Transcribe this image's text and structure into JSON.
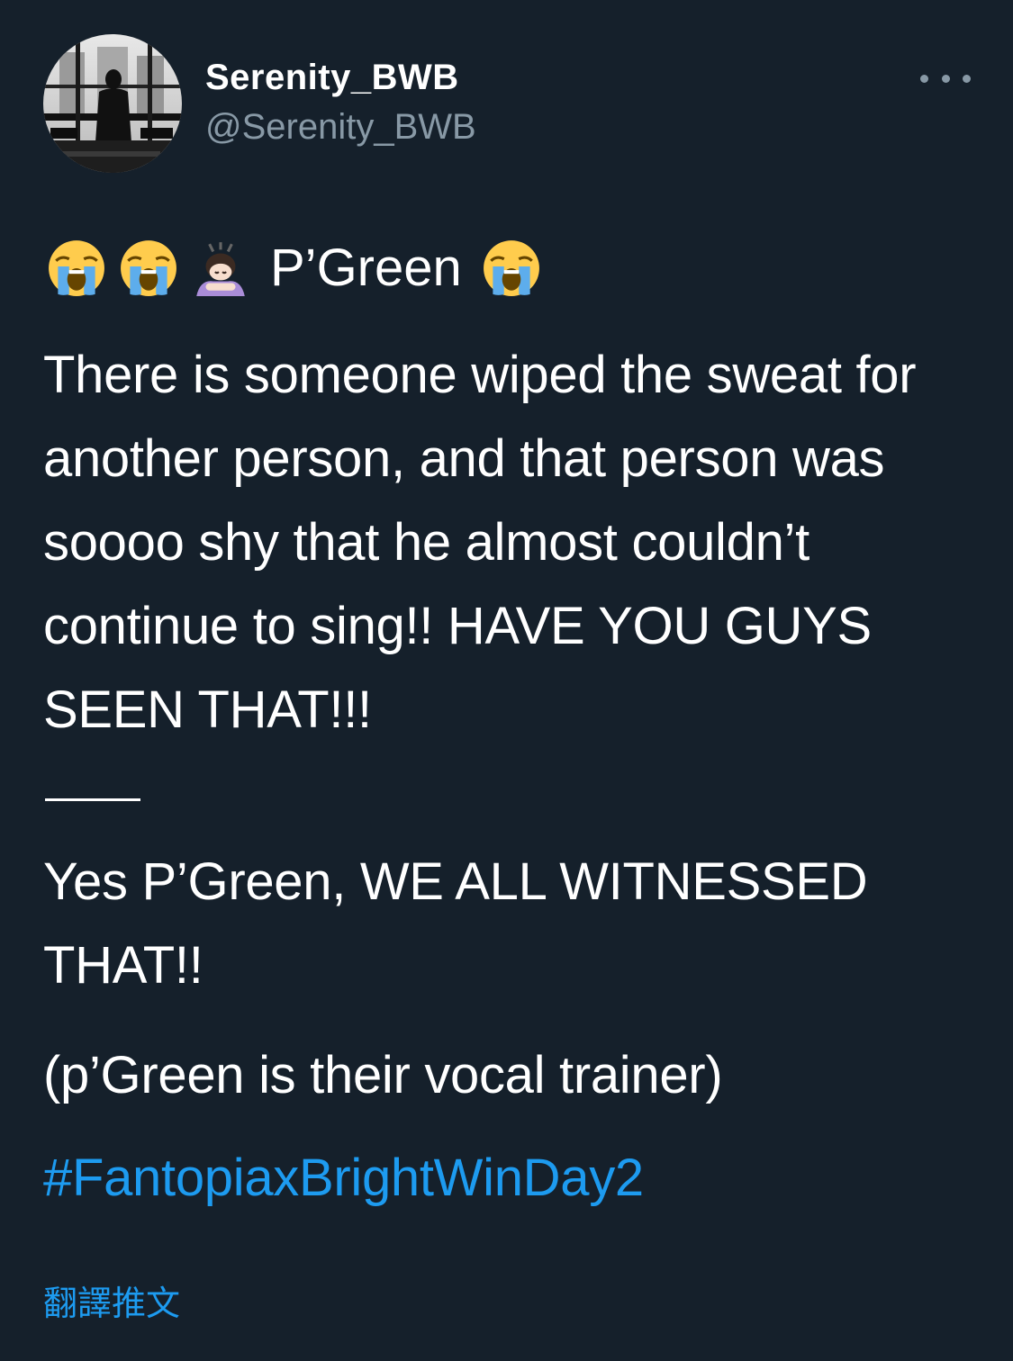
{
  "user": {
    "display_name": "Serenity_BWB",
    "handle": "@Serenity_BWB"
  },
  "tweet": {
    "emoji_line": {
      "icons": [
        "loudly-crying-face-icon",
        "loudly-crying-face-icon",
        "person-bowing-icon"
      ],
      "text": "P’Green",
      "trailing_icon": "loudly-crying-face-icon"
    },
    "body": "There is someone wiped the sweat for another person, and that person was soooo shy that he almost couldn’t continue to sing!! HAVE YOU GUYS SEEN THAT!!!",
    "reply": "Yes P’Green, WE ALL WITNESSED THAT!!",
    "note": "(p’Green is their vocal trainer)",
    "hashtag": "#FantopiaxBrightWinDay2",
    "translate_label": "翻譯推文"
  },
  "colors": {
    "background": "#15202b",
    "text_primary": "#ffffff",
    "text_secondary": "#8899a6",
    "link": "#1d9bf0"
  }
}
